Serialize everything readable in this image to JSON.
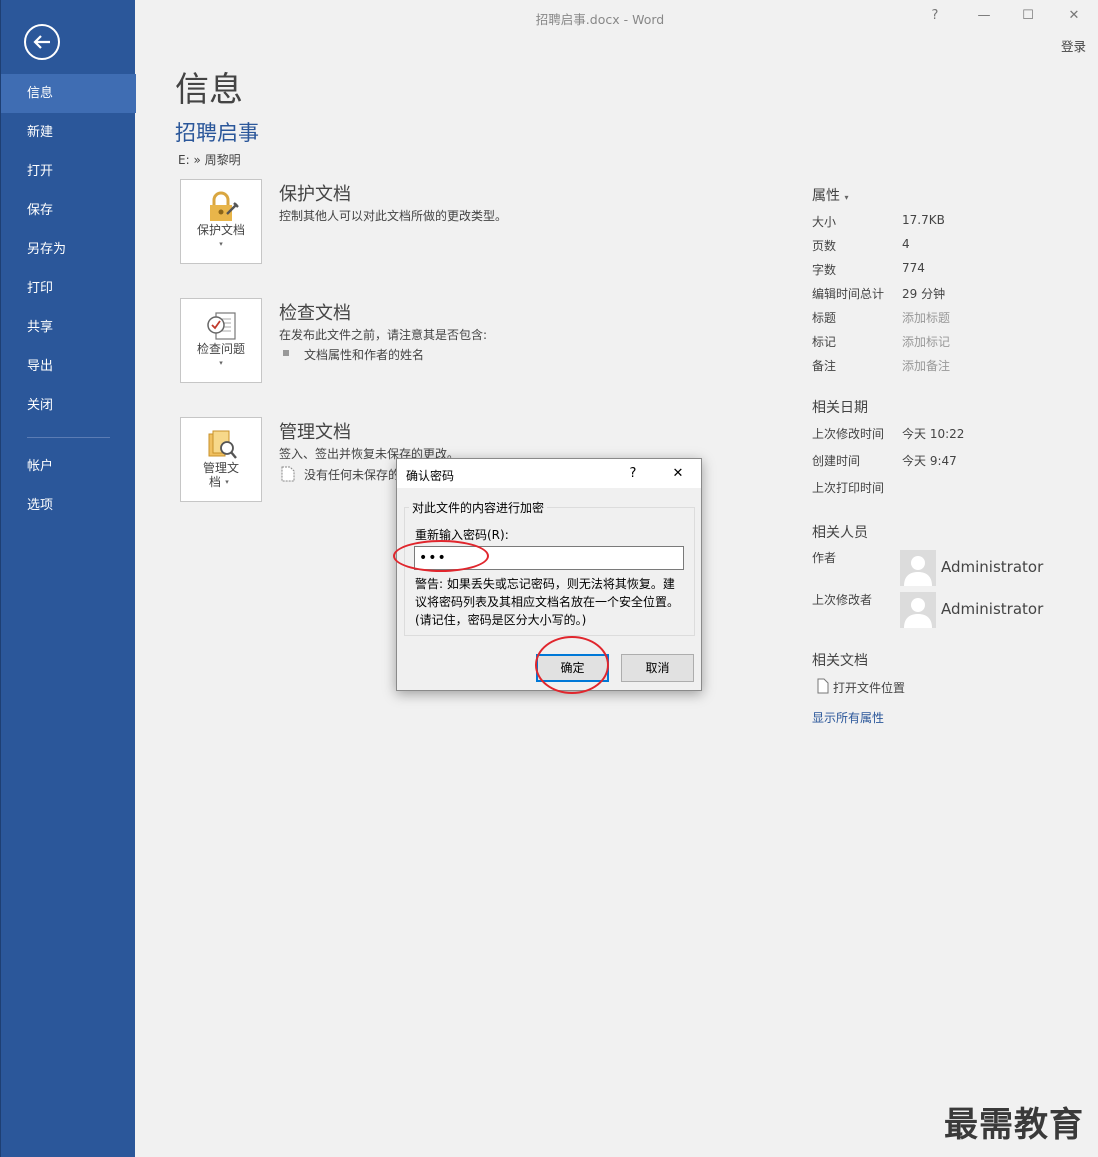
{
  "window": {
    "title": "招聘启事.docx - Word",
    "help": "?",
    "minimize": "—",
    "maximize": "☐",
    "close": "✕",
    "login": "登录"
  },
  "sidebar": {
    "items": [
      {
        "label": "信息"
      },
      {
        "label": "新建"
      },
      {
        "label": "打开"
      },
      {
        "label": "保存"
      },
      {
        "label": "另存为"
      },
      {
        "label": "打印"
      },
      {
        "label": "共享"
      },
      {
        "label": "导出"
      },
      {
        "label": "关闭"
      },
      {
        "label": "帐户"
      },
      {
        "label": "选项"
      }
    ]
  },
  "main": {
    "heading": "信息",
    "doc_name": "招聘启事",
    "doc_path": "E: » 周黎明",
    "protect": {
      "tile_label": "保护文档",
      "title": "保护文档",
      "desc": "控制其他人可以对此文档所做的更改类型。"
    },
    "inspect": {
      "tile_label": "检查问题",
      "title": "检查文档",
      "desc": "在发布此文件之前，请注意其是否包含:",
      "bullet": "文档属性和作者的姓名"
    },
    "manage": {
      "tile_label_1": "管理文",
      "tile_label_2": "档",
      "title": "管理文档",
      "desc": "签入、签出并恢复未保存的更改。",
      "item": "没有任何未保存的"
    },
    "caret": "▾"
  },
  "properties": {
    "header": "属性",
    "rows": [
      {
        "label": "大小",
        "value": "17.7KB"
      },
      {
        "label": "页数",
        "value": "4"
      },
      {
        "label": "字数",
        "value": "774"
      },
      {
        "label": "编辑时间总计",
        "value": "29 分钟"
      },
      {
        "label": "标题",
        "value": "添加标题"
      },
      {
        "label": "标记",
        "value": "添加标记"
      },
      {
        "label": "备注",
        "value": "添加备注"
      }
    ],
    "dates_title": "相关日期",
    "dates": [
      {
        "label": "上次修改时间",
        "value": "今天 10:22"
      },
      {
        "label": "创建时间",
        "value": "今天 9:47"
      },
      {
        "label": "上次打印时间",
        "value": ""
      }
    ],
    "people_title": "相关人员",
    "author_label": "作者",
    "author_name": "Administrator",
    "modifier_label": "上次修改者",
    "modifier_name": "Administrator",
    "docs_title": "相关文档",
    "open_location": "打开文件位置",
    "show_all": "显示所有属性"
  },
  "dialog": {
    "title": "确认密码",
    "help": "?",
    "close": "✕",
    "group_label": "对此文件的内容进行加密",
    "field_label": "重新输入密码(R):",
    "password_value": "•••",
    "warning": "警告: 如果丢失或忘记密码，则无法将其恢复。建议将密码列表及其相应文档名放在一个安全位置。(请记住，密码是区分大小写的。)",
    "ok": "确定",
    "cancel": "取消"
  },
  "watermark": "最需教育",
  "colors": {
    "sidebar": "#2b579a",
    "sidebar_active": "#3f6db3",
    "annotation": "#e0262d",
    "link": "#2b579a"
  }
}
